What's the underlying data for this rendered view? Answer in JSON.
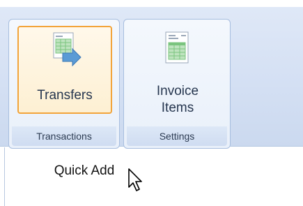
{
  "ribbon": {
    "groups": [
      {
        "caption": "Transactions",
        "button": {
          "label": "Transfers",
          "icon": "transfer-sheet-icon",
          "selected": true
        }
      },
      {
        "caption": "Settings",
        "button": {
          "label": "Invoice\nItems",
          "icon": "invoice-sheet-icon",
          "selected": false
        }
      }
    ]
  },
  "quick_add": {
    "label": "Quick Add"
  },
  "colors": {
    "accent_border": "#f2a43a",
    "ribbon_bg": "#d3dff3",
    "arrow": "#5b9bd5",
    "grid_green": "#7bc47f"
  }
}
